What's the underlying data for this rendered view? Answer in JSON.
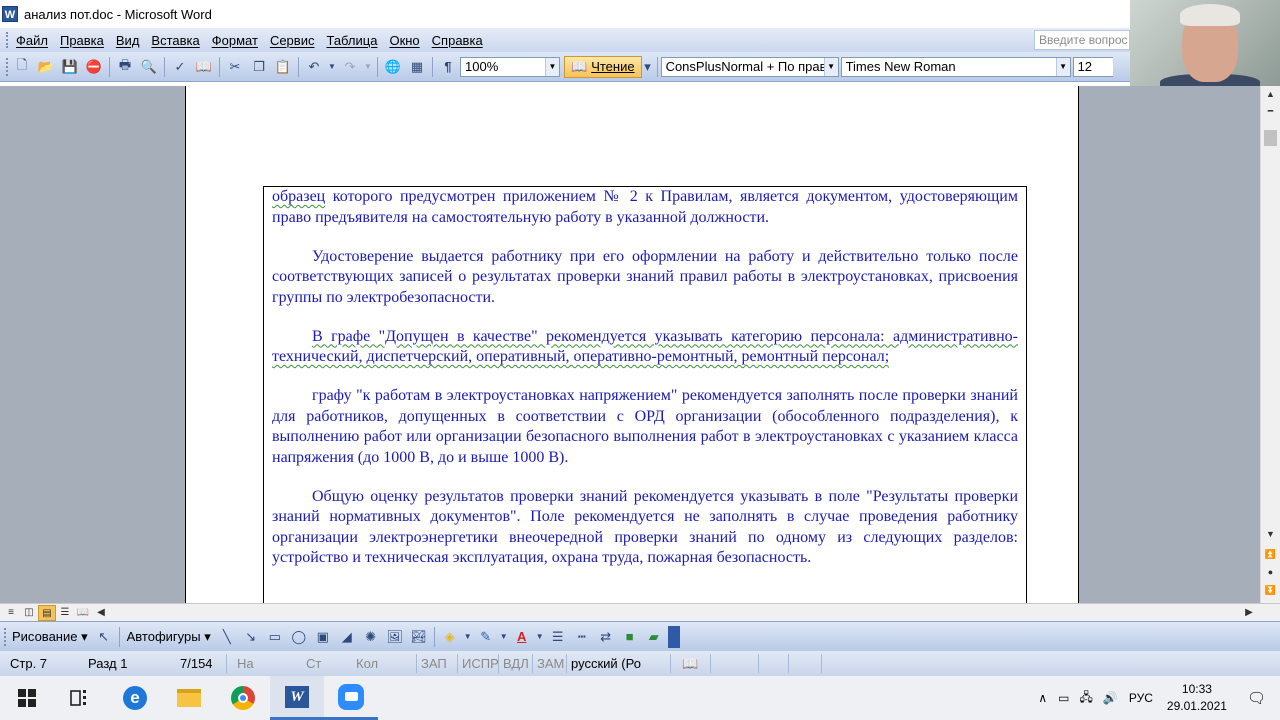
{
  "window": {
    "title": "анализ пот.doc - Microsoft Word",
    "app_icon": "W"
  },
  "menu": {
    "items": [
      "Файл",
      "Правка",
      "Вид",
      "Вставка",
      "Формат",
      "Сервис",
      "Таблица",
      "Окно",
      "Справка"
    ],
    "help_placeholder": "Введите вопрос"
  },
  "toolbar": {
    "zoom": "100%",
    "reading": "Чтение",
    "style": "ConsPlusNormal + По прав",
    "font": "Times New Roman",
    "size": "12"
  },
  "document": {
    "paragraphs": [
      {
        "lead": "образец",
        "text": " которого предусмотрен приложением № 2 к Правилам, является документом, удостоверяющим право предъявителя на самостоятельную работу в указанной должности."
      },
      {
        "text": "Удостоверение выдается работнику при его оформлении на работу и действительно только после соответствующих записей о результатах проверки знаний правил работы в электроустановках, присвоения группы по электробезопасности."
      },
      {
        "text": "В графе \"Допущен в качестве\" рекомендуется указывать категорию персонала: административно-технический, диспетчерский, оперативный, оперативно-ремонтный, ремонтный персонал;"
      },
      {
        "text": "графу \"к работам в электроустановках напряжением\" рекомендуется заполнять после проверки знаний для работников, допущенных в соответствии с ОРД организации (обособленного подразделения), к выполнению работ или организации безопасного выполнения работ в электроустановках с указанием класса напряжения (до 1000 В, до и выше 1000 В)."
      },
      {
        "text": "Общую оценку результатов проверки знаний рекомендуется указывать в поле \"Результаты проверки знаний нормативных документов\". Поле рекомендуется не заполнять в случае проведения работнику организации электроэнергетики внеочередной проверки знаний по одному из следующих разделов: устройство и техническая эксплуатация, охрана труда, пожарная безопасность."
      }
    ]
  },
  "drawing_toolbar": {
    "draw_label": "Рисование",
    "autoshapes_label": "Автофигуры"
  },
  "status": {
    "page": "Стр. 7",
    "section": "Разд 1",
    "pages": "7/154",
    "at": "На",
    "line": "Ст",
    "col": "Кол",
    "rec": "ЗАП",
    "trk": "ИСПР",
    "ext": "ВДЛ",
    "ovr": "ЗАМ",
    "language": "русский (Ро"
  },
  "taskbar": {
    "lang": "РУС",
    "time": "10:33",
    "date": "29.01.2021"
  }
}
